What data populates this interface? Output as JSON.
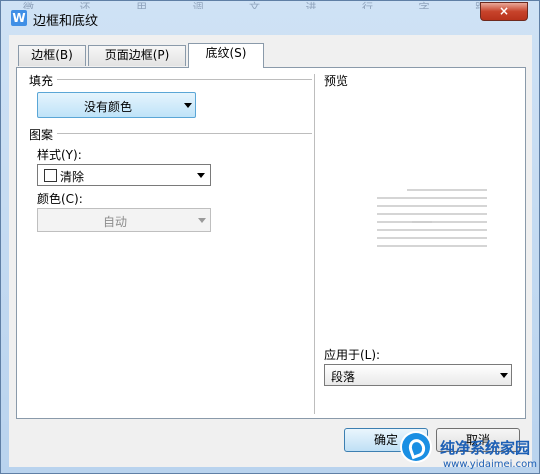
{
  "window": {
    "title": "边框和底纹",
    "app_icon_letter": "W",
    "close_glyph": "×",
    "background_text": "微 还 用 调 文 进 行 字 距 饰 设 置 的 文 字"
  },
  "tabs": [
    {
      "label": "边框(B)"
    },
    {
      "label": "页面边框(P)"
    },
    {
      "label": "底纹(S)",
      "active": true
    }
  ],
  "shading": {
    "fill_section": "填充",
    "fill_value": "没有颜色",
    "pattern_section": "图案",
    "style_label": "样式(Y):",
    "style_value": "清除",
    "color_label": "颜色(C):",
    "color_value": "自动"
  },
  "preview": {
    "section": "预览",
    "apply_to_label": "应用于(L):",
    "apply_to_value": "段落"
  },
  "buttons": {
    "ok": "确定",
    "cancel": "取消"
  },
  "watermark": {
    "text": "纯净系统家园",
    "url": "www.yidaimei.com"
  },
  "colors": {
    "title_bar": "#b9d3ee",
    "fill_button": "#bfe3f8",
    "close": "#c7432b",
    "watermark": "#1a8fe3"
  }
}
